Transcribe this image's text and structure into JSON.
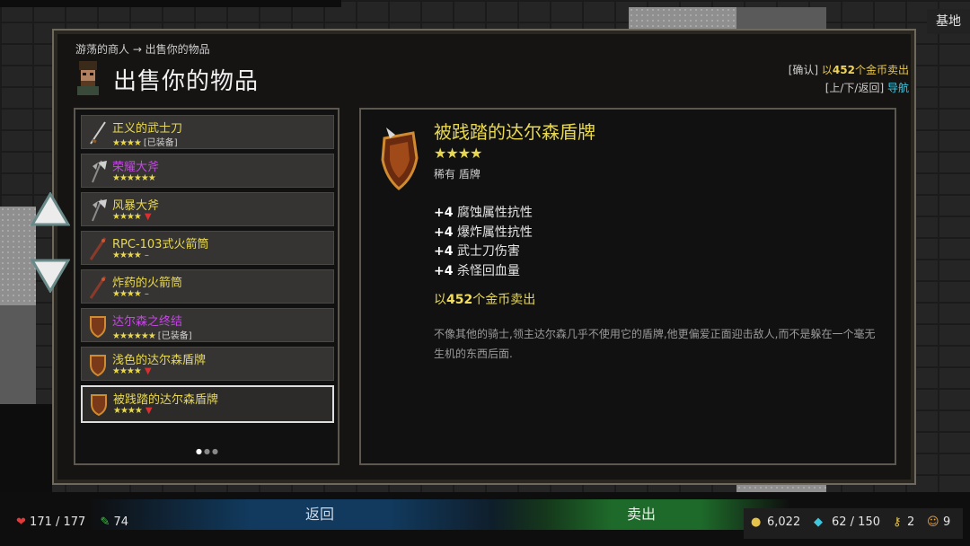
{
  "header": {
    "breadcrumb": "游荡的商人 → 出售你的物品",
    "title": "出售你的物品",
    "hint_confirm_prefix": "[确认]",
    "hint_confirm_text_pre": "以",
    "hint_confirm_amount": "452",
    "hint_confirm_text_post": "个金币卖出",
    "hint_nav_prefix": "[上/下/返回]",
    "hint_nav_text": "导航"
  },
  "base_button": "基地",
  "items": [
    {
      "name": "正义的武士刀",
      "stars": "★★★★",
      "tag": "[已装备]",
      "down": "",
      "dash": "",
      "rarity": "common"
    },
    {
      "name": "荣耀大斧",
      "stars": "★★★★★★",
      "tag": "",
      "down": "",
      "dash": "",
      "rarity": "epic"
    },
    {
      "name": "风暴大斧",
      "stars": "★★★★",
      "tag": "",
      "down": "▼",
      "dash": "",
      "rarity": "common"
    },
    {
      "name": "RPC-103式火箭筒",
      "stars": "★★★★",
      "tag": "",
      "down": "",
      "dash": "–",
      "rarity": "common"
    },
    {
      "name": "炸药的火箭筒",
      "stars": "★★★★",
      "tag": "",
      "down": "",
      "dash": "–",
      "rarity": "common"
    },
    {
      "name": "达尔森之终结",
      "stars": "★★★★★★",
      "tag": "[已装备]",
      "down": "",
      "dash": "",
      "rarity": "epic"
    },
    {
      "name": "浅色的达尔森盾牌",
      "stars": "★★★★",
      "tag": "",
      "down": "▼",
      "dash": "",
      "rarity": "common"
    },
    {
      "name": "被践踏的达尔森盾牌",
      "stars": "★★★★",
      "tag": "",
      "down": "▼",
      "dash": "",
      "rarity": "common",
      "selected": true
    }
  ],
  "detail": {
    "name": "被践踏的达尔森盾牌",
    "stars": "★★★★",
    "type": "稀有 盾牌",
    "stats": [
      {
        "value": "+4",
        "label": "腐蚀属性抗性"
      },
      {
        "value": "+4",
        "label": "爆炸属性抗性"
      },
      {
        "value": "+4",
        "label": "武士刀伤害"
      },
      {
        "value": "+4",
        "label": "杀怪回血量"
      }
    ],
    "price_pre": "以",
    "price_amount": "452",
    "price_post": "个金币卖出",
    "description": "不像其他的骑士,领主达尔森几乎不使用它的盾牌,他更偏爱正面迎击敌人,而不是躲在一个毫无生机的东西后面."
  },
  "bottom": {
    "back_label": "返回",
    "sell_label": "卖出",
    "health": "171 / 177",
    "stamina": "74",
    "gold": "6,022",
    "gems": "62 / 150",
    "keys": "2",
    "pets": "9"
  },
  "colors": {
    "common": "#e8d850",
    "epic": "#c14adf",
    "gold_highlight": "#f0d35a",
    "nav_cyan": "#3ec8e0"
  },
  "icons": {
    "heart": "heart-icon",
    "stamina": "syringe-icon",
    "coin": "coin-icon",
    "gem": "gem-icon",
    "key": "key-icon",
    "pet": "cat-icon"
  }
}
